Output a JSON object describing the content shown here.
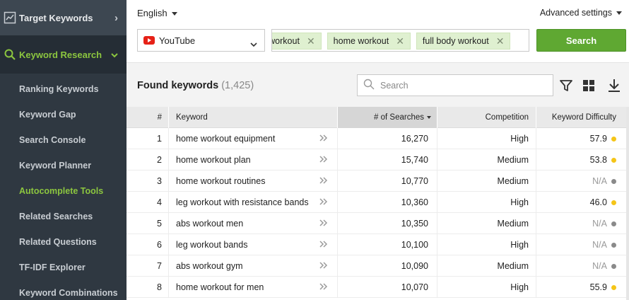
{
  "sidebar": {
    "top_item": {
      "label": "Target Keywords",
      "icon": "chart-icon"
    },
    "section": {
      "label": "Keyword Research",
      "icon": "search-icon"
    },
    "items": [
      {
        "label": "Ranking Keywords",
        "active": false
      },
      {
        "label": "Keyword Gap",
        "active": false
      },
      {
        "label": "Search Console",
        "active": false
      },
      {
        "label": "Keyword Planner",
        "active": false
      },
      {
        "label": "Autocomplete Tools",
        "active": true
      },
      {
        "label": "Related Searches",
        "active": false
      },
      {
        "label": "Related Questions",
        "active": false
      },
      {
        "label": "TF-IDF Explorer",
        "active": false
      },
      {
        "label": "Keyword Combinations",
        "active": false
      }
    ]
  },
  "header": {
    "language": "English",
    "advanced_settings": "Advanced settings",
    "source": "YouTube",
    "tags": [
      {
        "label": "leg workout"
      },
      {
        "label": "home workout"
      },
      {
        "label": "full body workout"
      }
    ],
    "search_button": "Search"
  },
  "found": {
    "title": "Found keywords",
    "count": "(1,425)",
    "search_placeholder": "Search"
  },
  "table": {
    "columns": [
      "#",
      "Keyword",
      "# of Searches",
      "Competition",
      "Keyword Difficulty"
    ],
    "rows": [
      {
        "n": "1",
        "keyword": "home workout equipment",
        "searches": "16,270",
        "competition": "High",
        "difficulty": "57.9",
        "status": "yellow"
      },
      {
        "n": "2",
        "keyword": "home workout plan",
        "searches": "15,740",
        "competition": "Medium",
        "difficulty": "53.8",
        "status": "yellow"
      },
      {
        "n": "3",
        "keyword": "home workout routines",
        "searches": "10,770",
        "competition": "Medium",
        "difficulty": "N/A",
        "status": "gray"
      },
      {
        "n": "4",
        "keyword": "leg workout with resistance bands",
        "searches": "10,360",
        "competition": "High",
        "difficulty": "46.0",
        "status": "yellow"
      },
      {
        "n": "5",
        "keyword": "abs workout men",
        "searches": "10,350",
        "competition": "Medium",
        "difficulty": "N/A",
        "status": "gray"
      },
      {
        "n": "6",
        "keyword": "leg workout bands",
        "searches": "10,100",
        "competition": "High",
        "difficulty": "N/A",
        "status": "gray"
      },
      {
        "n": "7",
        "keyword": "abs workout gym",
        "searches": "10,090",
        "competition": "Medium",
        "difficulty": "N/A",
        "status": "gray"
      },
      {
        "n": "8",
        "keyword": "home workout for men",
        "searches": "10,070",
        "competition": "High",
        "difficulty": "55.9",
        "status": "yellow"
      }
    ]
  },
  "colors": {
    "accent_green": "#8cc63f",
    "search_button": "#5fa832",
    "tag_bg": "#dff0d0",
    "status_yellow": "#f5c518",
    "status_gray": "#8a8a8a"
  }
}
